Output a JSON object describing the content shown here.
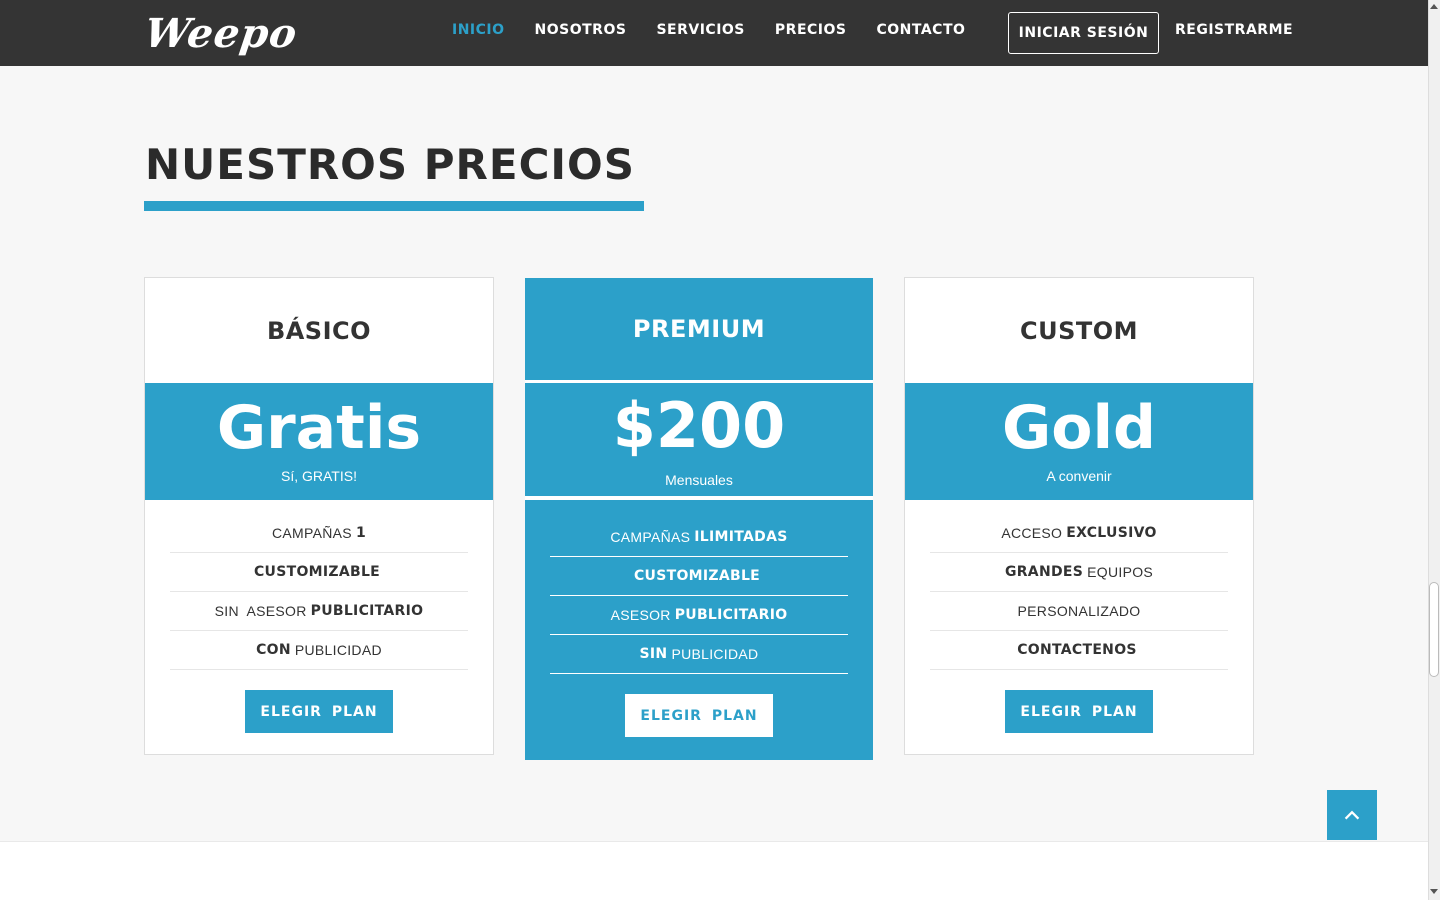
{
  "nav": {
    "logo": "Weepo",
    "links": [
      "INICIO",
      "NOSOTROS",
      "SERVICIOS",
      "PRECIOS",
      "CONTACTO"
    ],
    "login": "INICIAR SESIÓN",
    "register": "REGISTRARME",
    "active_color": "#2ca0c9"
  },
  "section": {
    "title": "NUESTROS PRECIOS"
  },
  "plans": {
    "basic": {
      "name": "BÁSICO",
      "price": "Gratis",
      "price_sub": "Sí, GRATIS!",
      "features": [
        {
          "text": "CAMPAÑAS",
          "bold": "1"
        },
        {
          "bold": "CUSTOMIZABLE"
        },
        {
          "text": "SIN  ASESOR",
          "bold": "PUBLICITARIO"
        },
        {
          "bold_lead": "CON",
          "text": "PUBLICIDAD"
        }
      ],
      "button": "ELEGIR PLAN"
    },
    "premium": {
      "name": "PREMIUM",
      "price": "$200",
      "price_sub": "Mensuales",
      "features": [
        {
          "text": "CAMPAÑAS",
          "bold": "ILIMITADAS"
        },
        {
          "bold": "CUSTOMIZABLE"
        },
        {
          "text": "ASESOR",
          "bold": "PUBLICITARIO"
        },
        {
          "bold_lead": "SIN",
          "text": "PUBLICIDAD"
        }
      ],
      "button": "ELEGIR PLAN"
    },
    "custom": {
      "name": "CUSTOM",
      "price": "Gold",
      "price_sub": "A convenir",
      "features": [
        {
          "text": "ACCESO",
          "bold": "EXCLUSIVO"
        },
        {
          "bold_lead": "GRANDES",
          "text": "EQUIPOS"
        },
        {
          "text": "PERSONALIZADO"
        },
        {
          "bold": "CONTACTENOS"
        }
      ],
      "button": "ELEGIR PLAN"
    }
  },
  "icons": {
    "to_top": "chevron-up-icon"
  },
  "colors": {
    "accent": "#2ca0c9",
    "navbar": "#343434"
  }
}
